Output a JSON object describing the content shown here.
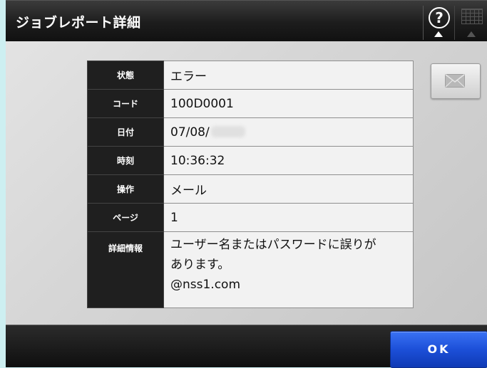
{
  "title": "ジョブレポート詳細",
  "icons": {
    "help": "help-icon",
    "keyboard": "keyboard-icon",
    "mail": "mail-icon"
  },
  "report": {
    "status_label": "状態",
    "status_value": "エラー",
    "code_label": "コード",
    "code_value": "100D0001",
    "date_label": "日付",
    "date_value": "07/08/",
    "time_label": "時刻",
    "time_value": "10:36:32",
    "operation_label": "操作",
    "operation_value": "メール",
    "pages_label": "ページ",
    "pages_value": "1",
    "detail_label": "詳細情報",
    "detail_lines": [
      "ユーザー名またはパスワードに誤りが",
      "あります。",
      "@nss1.com"
    ]
  },
  "footer": {
    "ok_label": "OK"
  },
  "colors": {
    "ok_button": "#1c4fd8",
    "titlebar": "#1d1d1d"
  }
}
